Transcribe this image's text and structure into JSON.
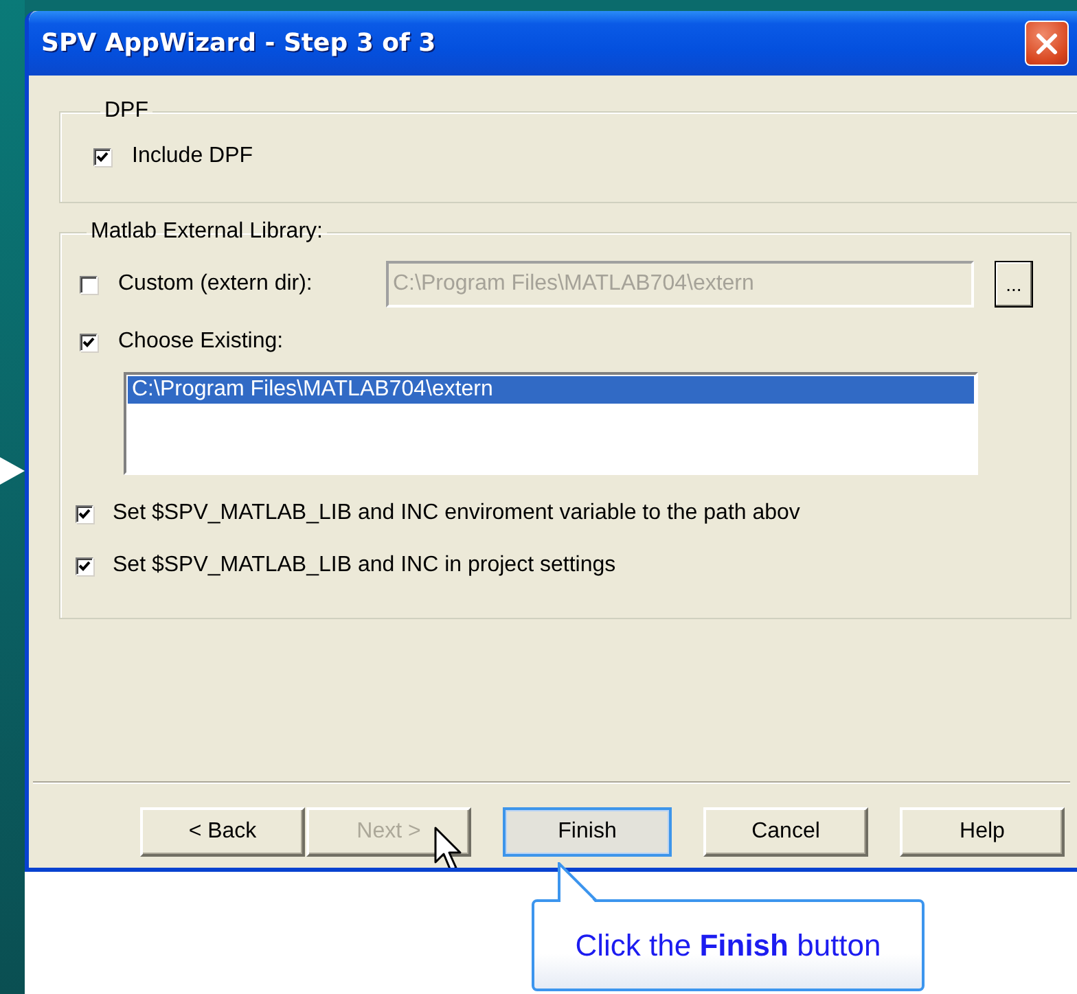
{
  "window": {
    "title": "SPV AppWizard - Step 3 of 3"
  },
  "dpf_group": {
    "title": "DPF",
    "include_dpf": {
      "label": "Include DPF",
      "checked": true
    }
  },
  "library_group": {
    "title": "Matlab External Library:",
    "custom": {
      "label": "Custom (extern dir):",
      "checked": false
    },
    "path_field": {
      "value": "C:\\Program Files\\MATLAB704\\extern",
      "disabled": true
    },
    "browse_button": "...",
    "choose_existing": {
      "label": "Choose Existing:",
      "checked": true
    },
    "list": [
      {
        "text": "C:\\Program Files\\MATLAB704\\extern",
        "selected": true
      }
    ],
    "options": [
      {
        "label": "Set $SPV_MATLAB_LIB and INC enviroment variable to the path abov",
        "checked": true
      },
      {
        "label": "Set $SPV_MATLAB_LIB and INC in project settings",
        "checked": true
      }
    ]
  },
  "buttons": [
    {
      "label": "< Back",
      "disabled": false,
      "focused": false
    },
    {
      "label": "Next >",
      "disabled": true,
      "focused": false
    },
    {
      "label": "Finish",
      "disabled": false,
      "focused": true
    },
    {
      "label": "Cancel",
      "disabled": false,
      "focused": false
    },
    {
      "label": "Help",
      "disabled": false,
      "focused": false
    }
  ],
  "callout": {
    "text": "Click the **Finish** button"
  }
}
